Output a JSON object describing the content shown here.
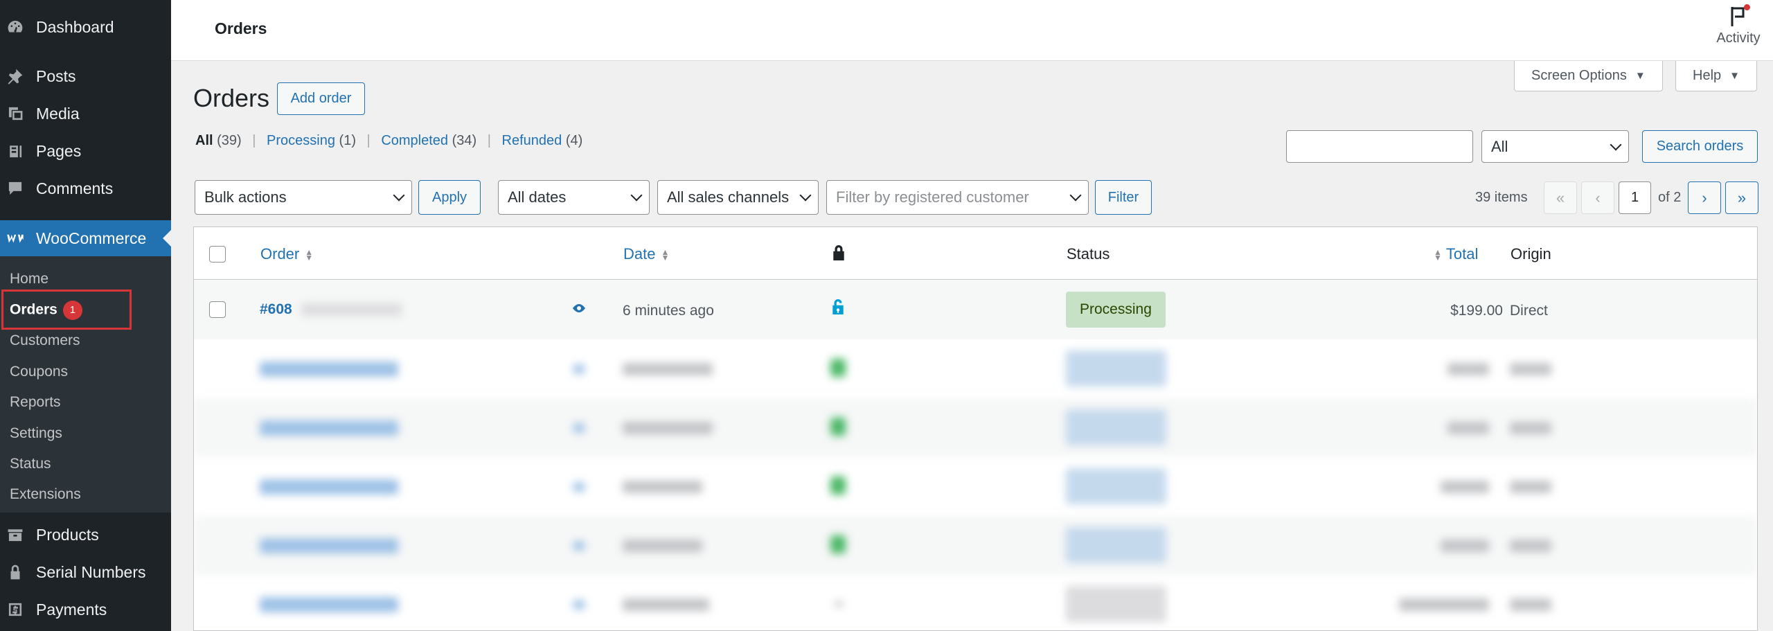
{
  "sidebar": {
    "top_items": [
      {
        "label": "Dashboard",
        "icon": "dashboard-icon"
      },
      {
        "label": "Posts",
        "icon": "pin-icon"
      },
      {
        "label": "Media",
        "icon": "media-icon"
      },
      {
        "label": "Pages",
        "icon": "pages-icon"
      },
      {
        "label": "Comments",
        "icon": "comment-icon"
      }
    ],
    "woocommerce": {
      "label": "WooCommerce",
      "icon": "woocommerce-icon"
    },
    "sub_items": [
      "Home",
      "Orders",
      "Customers",
      "Coupons",
      "Reports",
      "Settings",
      "Status",
      "Extensions"
    ],
    "orders_badge": "1",
    "bottom_items": [
      {
        "label": "Products",
        "icon": "archive-icon"
      },
      {
        "label": "Serial Numbers",
        "icon": "lock-icon"
      },
      {
        "label": "Payments",
        "icon": "dollar-icon"
      }
    ]
  },
  "header": {
    "title": "Orders",
    "activity_label": "Activity"
  },
  "tabs": {
    "screen_options": "Screen Options",
    "help": "Help"
  },
  "page": {
    "heading": "Orders",
    "add_order": "Add order"
  },
  "views": [
    {
      "label": "All",
      "count": "(39)",
      "current": true
    },
    {
      "label": "Processing",
      "count": "(1)"
    },
    {
      "label": "Completed",
      "count": "(34)"
    },
    {
      "label": "Refunded",
      "count": "(4)"
    }
  ],
  "search": {
    "input_value": "",
    "type_selected": "All",
    "button": "Search orders"
  },
  "filters": {
    "bulk_actions": "Bulk actions",
    "apply": "Apply",
    "dates": "All dates",
    "channels": "All sales channels",
    "customer_placeholder": "Filter by registered customer",
    "filter_button": "Filter"
  },
  "pagination": {
    "items": "39 items",
    "first": "«",
    "prev": "‹",
    "current_page": "1",
    "of_pages": "of 2",
    "next": "›",
    "last": "»"
  },
  "table": {
    "columns": {
      "order": "Order",
      "date": "Date",
      "status": "Status",
      "total": "Total",
      "origin": "Origin"
    },
    "first_row": {
      "order": "#608",
      "date": "6 minutes ago",
      "status": "Processing",
      "total": "$199.00",
      "origin": "Direct"
    }
  },
  "colors": {
    "sidebar_bg": "#1d2327",
    "accent": "#2271b1",
    "processing_bg": "#c6e1c6",
    "badge": "#d63638"
  }
}
